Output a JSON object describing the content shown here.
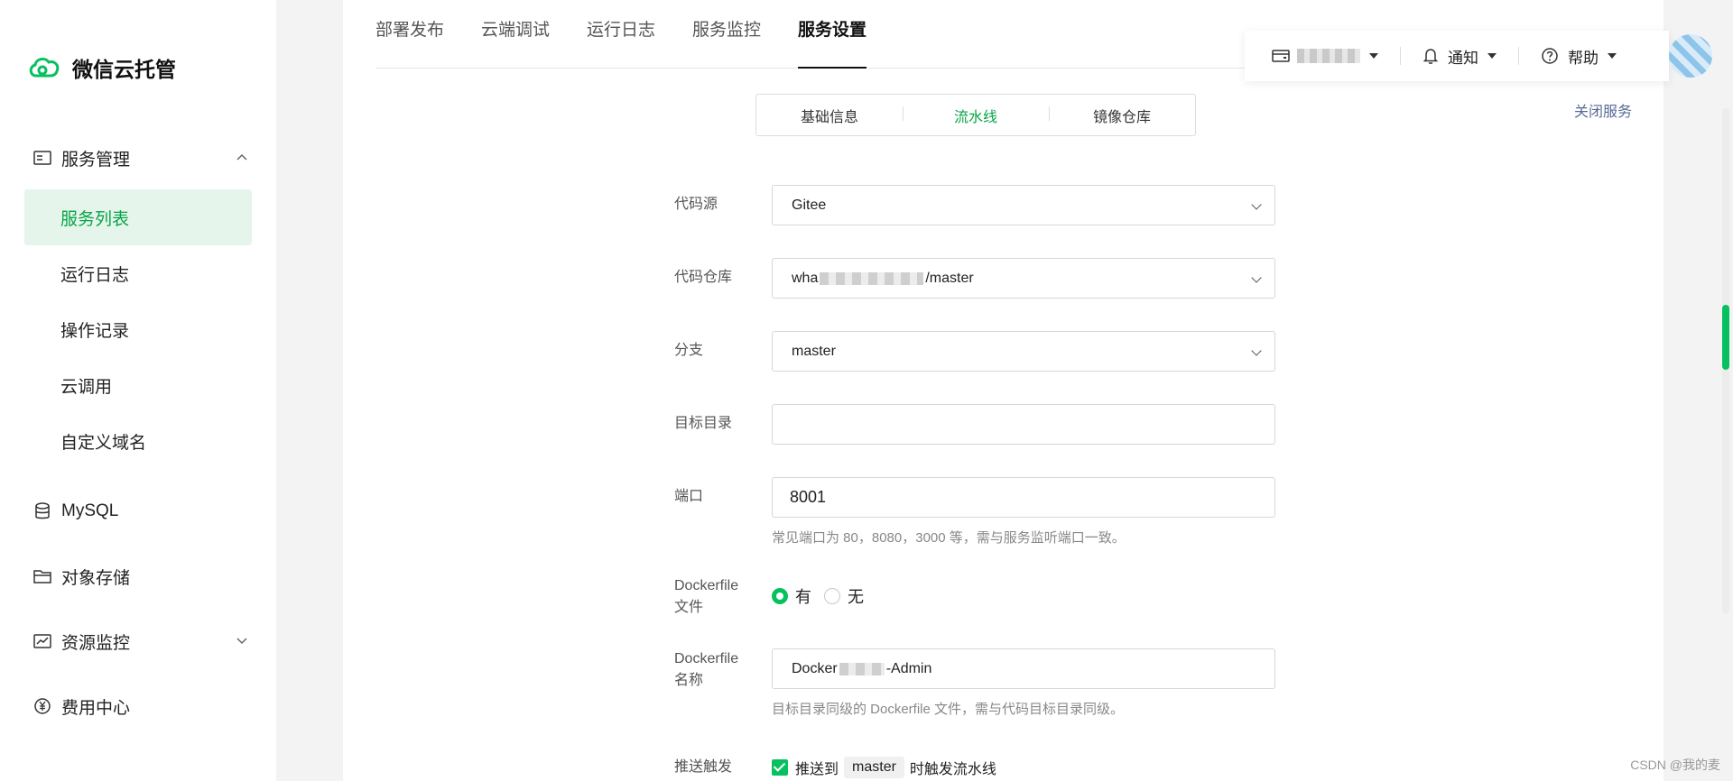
{
  "brand": {
    "name": "微信云托管",
    "accent": "#07c160"
  },
  "sidebar": {
    "groups": [
      {
        "label": "服务管理",
        "icon": "server-icon",
        "expanded": true,
        "items": [
          {
            "label": "服务列表",
            "active": true
          },
          {
            "label": "运行日志",
            "active": false
          },
          {
            "label": "操作记录",
            "active": false
          },
          {
            "label": "云调用",
            "active": false
          },
          {
            "label": "自定义域名",
            "active": false
          }
        ]
      },
      {
        "label": "MySQL",
        "icon": "database-icon"
      },
      {
        "label": "对象存储",
        "icon": "folder-icon"
      },
      {
        "label": "资源监控",
        "icon": "monitor-chart-icon",
        "expanded": false
      },
      {
        "label": "费用中心",
        "icon": "yen-icon"
      }
    ]
  },
  "tabs": [
    "部署发布",
    "云端调试",
    "运行日志",
    "服务监控",
    "服务设置"
  ],
  "active_tab": "服务设置",
  "topbar": {
    "notify_label": "通知",
    "help_label": "帮助"
  },
  "segments": [
    "基础信息",
    "流水线",
    "镜像仓库"
  ],
  "active_segment": "流水线",
  "close_service": "关闭服务",
  "form": {
    "code_source_label": "代码源",
    "code_source_value": "Gitee",
    "repo_label": "代码仓库",
    "repo_prefix": "wha",
    "repo_suffix": "/master",
    "branch_label": "分支",
    "branch_value": "master",
    "target_dir_label": "目标目录",
    "target_dir_value": "",
    "port_label": "端口",
    "port_value": "8001",
    "port_hint": "常见端口为 80，8080，3000 等，需与服务监听端口一致。",
    "dockerfile_label_1": "Dockerfile",
    "dockerfile_label_2": "文件",
    "dockerfile_yes": "有",
    "dockerfile_no": "无",
    "dockerfile_name_label_1": "Dockerfile",
    "dockerfile_name_label_2": "名称",
    "dockerfile_name_prefix": "Docker",
    "dockerfile_name_suffix": "-Admin",
    "dockerfile_hint": "目标目录同级的 Dockerfile 文件，需与代码目标目录同级。",
    "push_trigger_label": "推送触发",
    "push_prefix": "推送到",
    "push_branch": "master",
    "push_suffix": "时触发流水线"
  },
  "watermark": "CSDN @我的麦"
}
